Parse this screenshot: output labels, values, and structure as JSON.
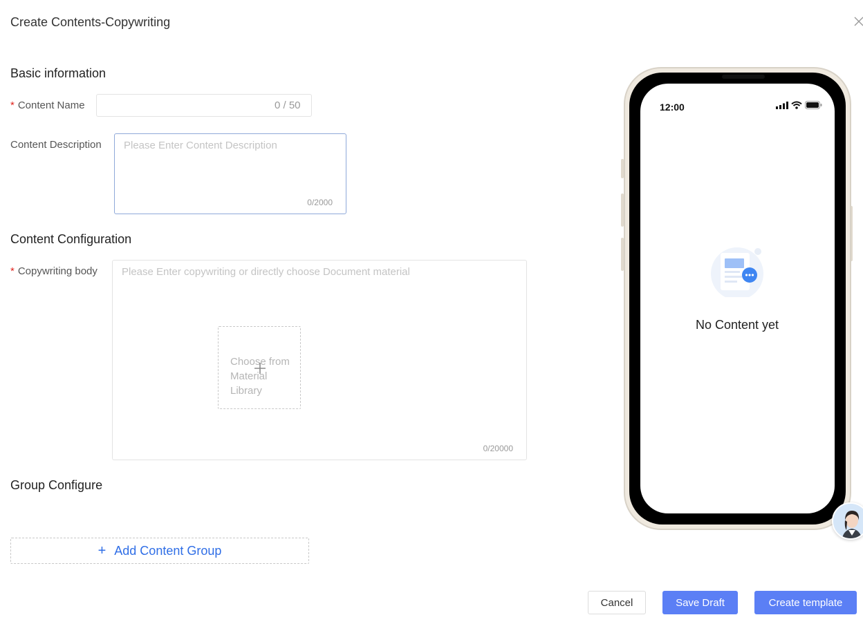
{
  "dialog": {
    "title": "Create Contents-Copywriting",
    "close_icon": "close-icon"
  },
  "basic": {
    "section_title": "Basic information",
    "name_label": "Content Name",
    "name_value": "",
    "name_counter": "0 / 50",
    "desc_label": "Content Description",
    "desc_placeholder": "Please Enter Content Description",
    "desc_counter": "0/2000"
  },
  "config": {
    "section_title": "Content Configuration",
    "body_label": "Copywriting body",
    "body_placeholder": "Please Enter copywriting or directly choose Document material",
    "choose_label": "Choose from Material Library",
    "body_counter": "0/20000"
  },
  "group": {
    "section_title": "Group Configure",
    "add_label": "Add Content Group",
    "add_icon": "plus-icon"
  },
  "preview": {
    "time": "12:00",
    "empty_text": "No Content yet",
    "empty_icon": "chat-document-icon"
  },
  "footer": {
    "cancel": "Cancel",
    "save_draft": "Save Draft",
    "create": "Create template"
  },
  "colors": {
    "primary": "#5b7ff5",
    "link": "#2f6ee6",
    "required": "#e0251f"
  }
}
